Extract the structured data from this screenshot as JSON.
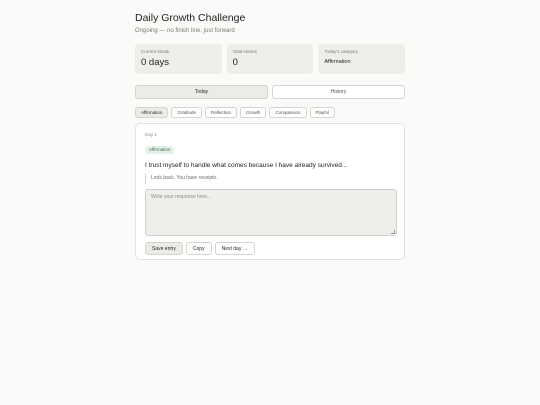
{
  "header": {
    "title": "Daily Growth Challenge",
    "subtitle": "Ongoing — no finish line, just forward"
  },
  "stats": [
    {
      "label": "Current streak",
      "value": "0 days"
    },
    {
      "label": "Total entries",
      "value": "0"
    },
    {
      "label": "Today's category",
      "value": "Affirmation"
    }
  ],
  "tabs": [
    {
      "label": "Today",
      "active": true
    },
    {
      "label": "History",
      "active": false
    }
  ],
  "categories": [
    {
      "label": "Affirmation",
      "active": true
    },
    {
      "label": "Gratitude",
      "active": false
    },
    {
      "label": "Reflection",
      "active": false
    },
    {
      "label": "Growth",
      "active": false
    },
    {
      "label": "Compassion",
      "active": false
    },
    {
      "label": "Playful",
      "active": false
    }
  ],
  "card": {
    "day_label": "Day 1",
    "badge": "Affirmation",
    "prompt": "I trust myself to handle what comes because I have already survived...",
    "hint": "Look back. You have receipts.",
    "response_placeholder": "Write your response here...",
    "response_value": ""
  },
  "actions": {
    "save_label": "Save entry",
    "copy_label": "Copy",
    "next_label": "Next day →"
  },
  "colors": {
    "background": "#fbfaf8",
    "card_bg": "#ffffff",
    "stat_bg": "#efeeeb",
    "badge_bg": "#e3f1e7",
    "badge_text": "#3d6b4c"
  }
}
